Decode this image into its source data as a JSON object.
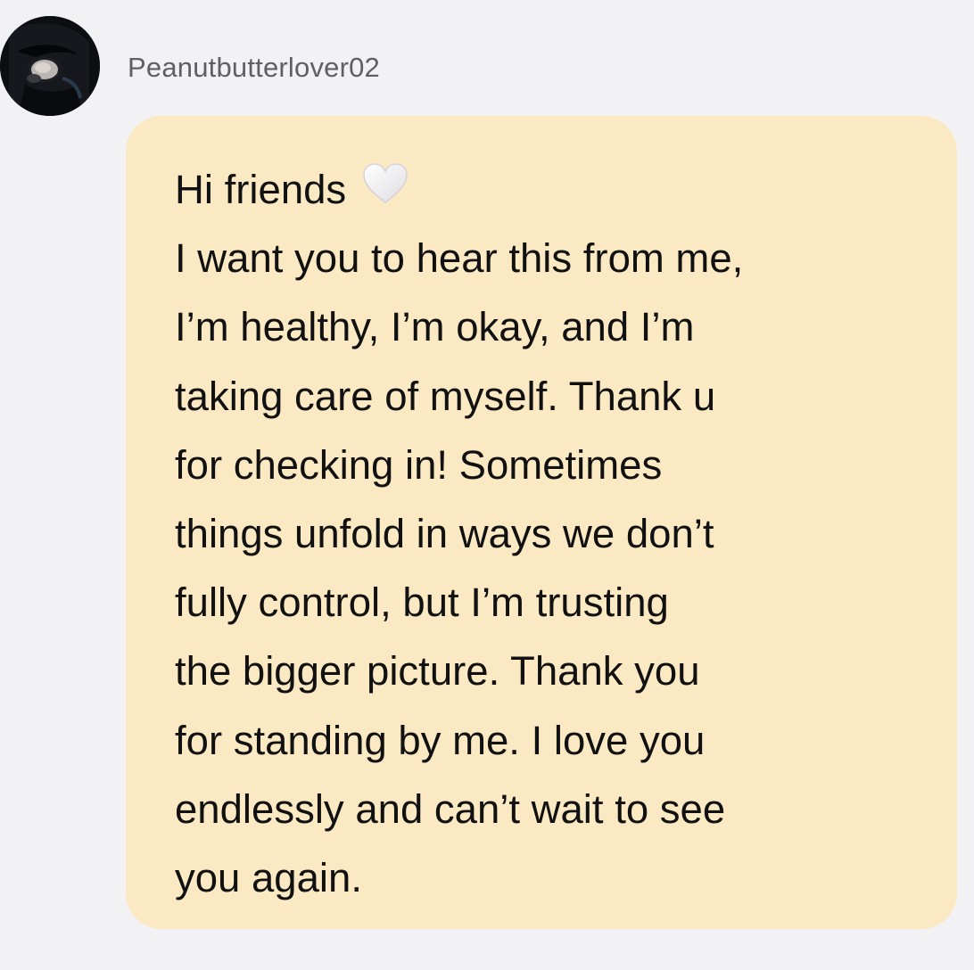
{
  "message": {
    "username": "Peanutbutterlover02",
    "greeting": "Hi friends",
    "greeting_icon": "white-heart-icon",
    "body_lines": [
      "I want you to hear this from me,",
      "I’m healthy, I’m okay, and I’m",
      "taking care of myself. Thank u",
      "for checking in! Sometimes",
      "things unfold in ways we don’t",
      "fully control, but I’m trusting",
      "the bigger picture. Thank you",
      "for standing by me. I love you",
      "endlessly and can’t wait to see",
      "you again."
    ]
  },
  "colors": {
    "background": "#f2f2f4",
    "bubble": "#fbe9c4",
    "text": "#111111",
    "username": "#5f5f64",
    "heart": "#f4f4f5"
  }
}
